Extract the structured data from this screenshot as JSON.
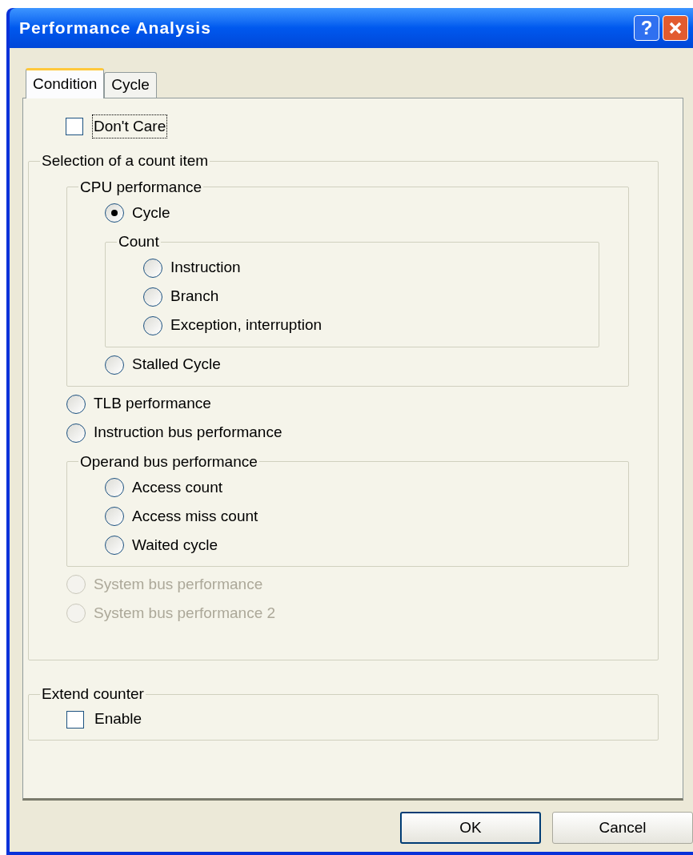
{
  "window": {
    "title": "Performance Analysis",
    "help_button": "?"
  },
  "tabs": [
    {
      "label": "Condition",
      "selected": true
    },
    {
      "label": "Cycle",
      "selected": false
    }
  ],
  "items": [
    {
      "kind": "checkbox",
      "label": "Don't Care",
      "checked": false,
      "focused": true
    },
    {
      "kind": "group",
      "label": "Selection of a count item",
      "children": [
        {
          "kind": "group",
          "label": "CPU performance",
          "children": [
            {
              "kind": "radio",
              "label": "Cycle",
              "selected": true,
              "disabled": false
            },
            {
              "kind": "group",
              "label": "Count",
              "children": [
                {
                  "kind": "radio",
                  "label": "Instruction",
                  "selected": false,
                  "disabled": false
                },
                {
                  "kind": "radio",
                  "label": "Branch",
                  "selected": false,
                  "disabled": false
                },
                {
                  "kind": "radio",
                  "label": "Exception, interruption",
                  "selected": false,
                  "disabled": false
                }
              ]
            },
            {
              "kind": "radio",
              "label": "Stalled Cycle",
              "selected": false,
              "disabled": false
            }
          ]
        },
        {
          "kind": "radio",
          "label": "TLB performance",
          "selected": false,
          "disabled": false
        },
        {
          "kind": "radio",
          "label": "Instruction bus performance",
          "selected": false,
          "disabled": false
        },
        {
          "kind": "group",
          "label": "Operand bus performance",
          "children": [
            {
              "kind": "radio",
              "label": "Access count",
              "selected": false,
              "disabled": false
            },
            {
              "kind": "radio",
              "label": "Access miss count",
              "selected": false,
              "disabled": false
            },
            {
              "kind": "radio",
              "label": "Waited cycle",
              "selected": false,
              "disabled": false
            }
          ]
        },
        {
          "kind": "radio",
          "label": "System bus performance",
          "selected": false,
          "disabled": true
        },
        {
          "kind": "radio",
          "label": "System bus performance 2",
          "selected": false,
          "disabled": true
        }
      ]
    },
    {
      "kind": "group",
      "label": "Extend counter",
      "children": [
        {
          "kind": "checkbox",
          "label": "Enable",
          "checked": false,
          "focused": false
        }
      ]
    }
  ],
  "buttons": [
    {
      "label": "OK",
      "default": true
    },
    {
      "label": "Cancel",
      "default": false
    }
  ]
}
